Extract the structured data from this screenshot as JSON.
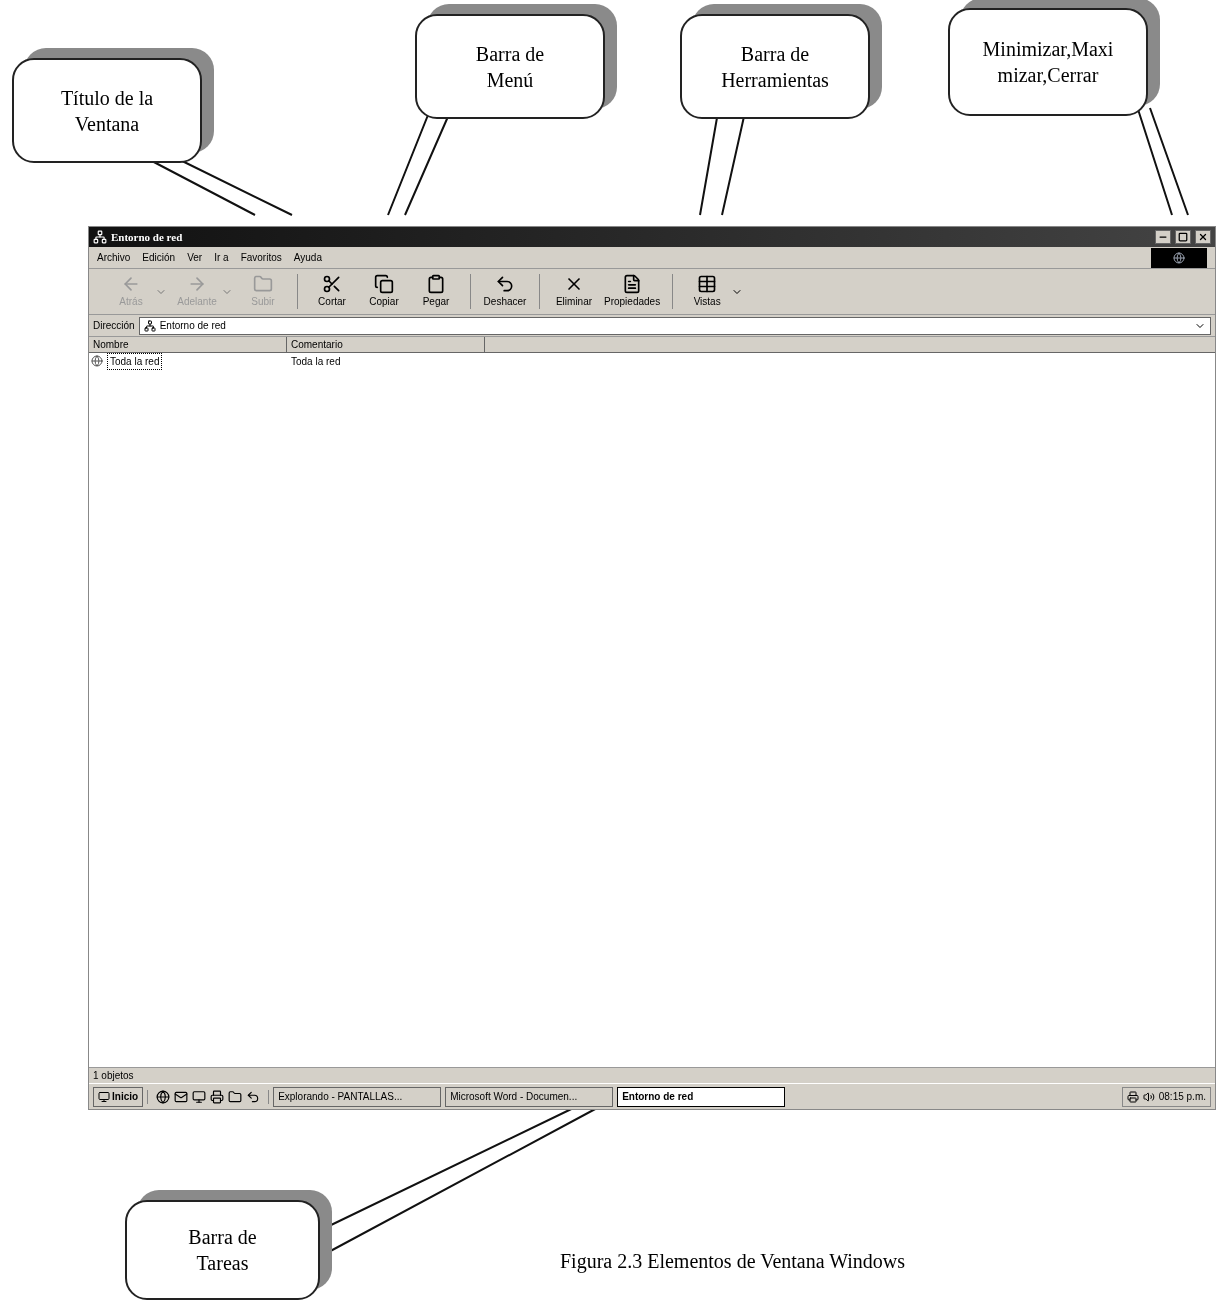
{
  "callouts": [
    {
      "lines": [
        "Título de la",
        "Ventana"
      ]
    },
    {
      "lines": [
        "Barra de",
        "Menú"
      ]
    },
    {
      "lines": [
        "Barra de",
        "Herramientas"
      ]
    },
    {
      "lines": [
        "Minimizar,Maxi",
        "mizar,Cerrar"
      ]
    },
    {
      "lines": [
        "Barra de",
        "Tareas"
      ]
    }
  ],
  "window": {
    "title": "Entorno de red",
    "menu": [
      "Archivo",
      "Edición",
      "Ver",
      "Ir a",
      "Favoritos",
      "Ayuda"
    ],
    "toolbar": [
      {
        "buttons": [
          {
            "label": "Atrás",
            "disabled": true,
            "has_menu": true
          },
          {
            "label": "Adelante",
            "disabled": true,
            "has_menu": true
          },
          {
            "label": "Subir",
            "disabled": true,
            "has_menu": false
          }
        ]
      },
      {
        "buttons": [
          {
            "label": "Cortar",
            "disabled": false,
            "has_menu": false
          },
          {
            "label": "Copiar",
            "disabled": false,
            "has_menu": false
          },
          {
            "label": "Pegar",
            "disabled": false,
            "has_menu": false
          }
        ]
      },
      {
        "buttons": [
          {
            "label": "Deshacer",
            "disabled": false,
            "has_menu": false
          }
        ]
      },
      {
        "buttons": [
          {
            "label": "Eliminar",
            "disabled": false,
            "has_menu": false
          },
          {
            "label": "Propiedades",
            "disabled": false,
            "has_menu": false
          }
        ]
      },
      {
        "buttons": [
          {
            "label": "Vistas",
            "disabled": false,
            "has_menu": true
          }
        ]
      }
    ],
    "address": {
      "label": "Dirección",
      "value": "Entorno de red"
    },
    "columns": [
      "Nombre",
      "Comentario"
    ],
    "rows": [
      {
        "name": "Toda la red",
        "comment": "Toda la red",
        "selected": true
      }
    ],
    "status_bar": "1 objetos"
  },
  "taskbar": {
    "start": "Inicio",
    "tasks": [
      {
        "label": "Explorando - PANTALLAS...",
        "selected": false
      },
      {
        "label": "Microsoft Word - Documen...",
        "selected": false
      },
      {
        "label": "Entorno de red",
        "selected": true
      }
    ],
    "clock": "08:15 p.m."
  },
  "caption": "Figura 2.3 Elementos de Ventana Windows"
}
